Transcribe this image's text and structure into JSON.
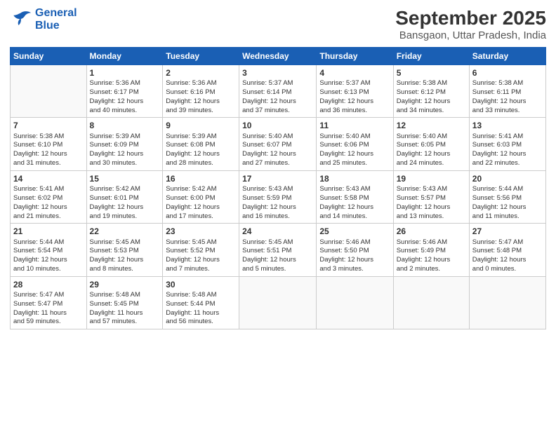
{
  "logo": {
    "line1": "General",
    "line2": "Blue"
  },
  "title": "September 2025",
  "subtitle": "Bansgaon, Uttar Pradesh, India",
  "days_of_week": [
    "Sunday",
    "Monday",
    "Tuesday",
    "Wednesday",
    "Thursday",
    "Friday",
    "Saturday"
  ],
  "weeks": [
    [
      {
        "day": "",
        "info": ""
      },
      {
        "day": "1",
        "info": "Sunrise: 5:36 AM\nSunset: 6:17 PM\nDaylight: 12 hours\nand 40 minutes."
      },
      {
        "day": "2",
        "info": "Sunrise: 5:36 AM\nSunset: 6:16 PM\nDaylight: 12 hours\nand 39 minutes."
      },
      {
        "day": "3",
        "info": "Sunrise: 5:37 AM\nSunset: 6:14 PM\nDaylight: 12 hours\nand 37 minutes."
      },
      {
        "day": "4",
        "info": "Sunrise: 5:37 AM\nSunset: 6:13 PM\nDaylight: 12 hours\nand 36 minutes."
      },
      {
        "day": "5",
        "info": "Sunrise: 5:38 AM\nSunset: 6:12 PM\nDaylight: 12 hours\nand 34 minutes."
      },
      {
        "day": "6",
        "info": "Sunrise: 5:38 AM\nSunset: 6:11 PM\nDaylight: 12 hours\nand 33 minutes."
      }
    ],
    [
      {
        "day": "7",
        "info": "Sunrise: 5:38 AM\nSunset: 6:10 PM\nDaylight: 12 hours\nand 31 minutes."
      },
      {
        "day": "8",
        "info": "Sunrise: 5:39 AM\nSunset: 6:09 PM\nDaylight: 12 hours\nand 30 minutes."
      },
      {
        "day": "9",
        "info": "Sunrise: 5:39 AM\nSunset: 6:08 PM\nDaylight: 12 hours\nand 28 minutes."
      },
      {
        "day": "10",
        "info": "Sunrise: 5:40 AM\nSunset: 6:07 PM\nDaylight: 12 hours\nand 27 minutes."
      },
      {
        "day": "11",
        "info": "Sunrise: 5:40 AM\nSunset: 6:06 PM\nDaylight: 12 hours\nand 25 minutes."
      },
      {
        "day": "12",
        "info": "Sunrise: 5:40 AM\nSunset: 6:05 PM\nDaylight: 12 hours\nand 24 minutes."
      },
      {
        "day": "13",
        "info": "Sunrise: 5:41 AM\nSunset: 6:03 PM\nDaylight: 12 hours\nand 22 minutes."
      }
    ],
    [
      {
        "day": "14",
        "info": "Sunrise: 5:41 AM\nSunset: 6:02 PM\nDaylight: 12 hours\nand 21 minutes."
      },
      {
        "day": "15",
        "info": "Sunrise: 5:42 AM\nSunset: 6:01 PM\nDaylight: 12 hours\nand 19 minutes."
      },
      {
        "day": "16",
        "info": "Sunrise: 5:42 AM\nSunset: 6:00 PM\nDaylight: 12 hours\nand 17 minutes."
      },
      {
        "day": "17",
        "info": "Sunrise: 5:43 AM\nSunset: 5:59 PM\nDaylight: 12 hours\nand 16 minutes."
      },
      {
        "day": "18",
        "info": "Sunrise: 5:43 AM\nSunset: 5:58 PM\nDaylight: 12 hours\nand 14 minutes."
      },
      {
        "day": "19",
        "info": "Sunrise: 5:43 AM\nSunset: 5:57 PM\nDaylight: 12 hours\nand 13 minutes."
      },
      {
        "day": "20",
        "info": "Sunrise: 5:44 AM\nSunset: 5:56 PM\nDaylight: 12 hours\nand 11 minutes."
      }
    ],
    [
      {
        "day": "21",
        "info": "Sunrise: 5:44 AM\nSunset: 5:54 PM\nDaylight: 12 hours\nand 10 minutes."
      },
      {
        "day": "22",
        "info": "Sunrise: 5:45 AM\nSunset: 5:53 PM\nDaylight: 12 hours\nand 8 minutes."
      },
      {
        "day": "23",
        "info": "Sunrise: 5:45 AM\nSunset: 5:52 PM\nDaylight: 12 hours\nand 7 minutes."
      },
      {
        "day": "24",
        "info": "Sunrise: 5:45 AM\nSunset: 5:51 PM\nDaylight: 12 hours\nand 5 minutes."
      },
      {
        "day": "25",
        "info": "Sunrise: 5:46 AM\nSunset: 5:50 PM\nDaylight: 12 hours\nand 3 minutes."
      },
      {
        "day": "26",
        "info": "Sunrise: 5:46 AM\nSunset: 5:49 PM\nDaylight: 12 hours\nand 2 minutes."
      },
      {
        "day": "27",
        "info": "Sunrise: 5:47 AM\nSunset: 5:48 PM\nDaylight: 12 hours\nand 0 minutes."
      }
    ],
    [
      {
        "day": "28",
        "info": "Sunrise: 5:47 AM\nSunset: 5:47 PM\nDaylight: 11 hours\nand 59 minutes."
      },
      {
        "day": "29",
        "info": "Sunrise: 5:48 AM\nSunset: 5:45 PM\nDaylight: 11 hours\nand 57 minutes."
      },
      {
        "day": "30",
        "info": "Sunrise: 5:48 AM\nSunset: 5:44 PM\nDaylight: 11 hours\nand 56 minutes."
      },
      {
        "day": "",
        "info": ""
      },
      {
        "day": "",
        "info": ""
      },
      {
        "day": "",
        "info": ""
      },
      {
        "day": "",
        "info": ""
      }
    ]
  ]
}
